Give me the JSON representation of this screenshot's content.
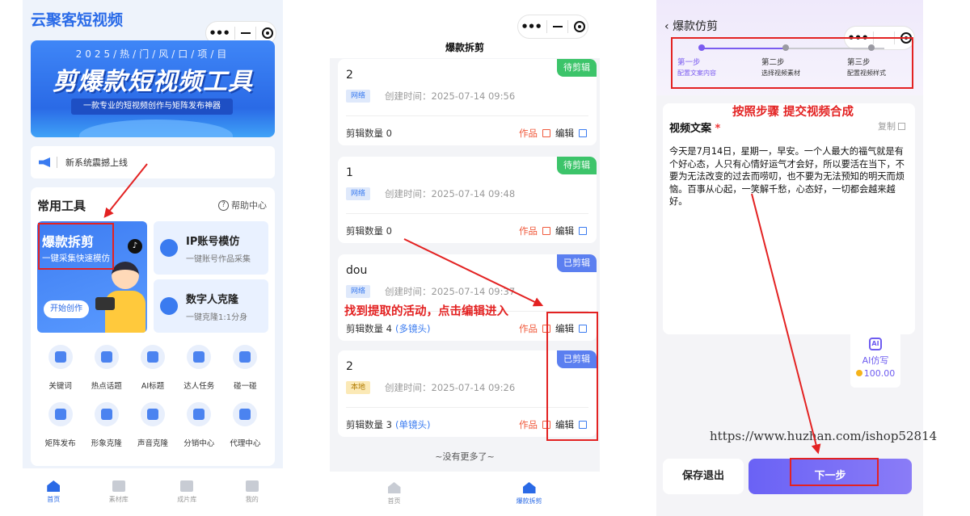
{
  "colors": {
    "accent_blue": "#2a6ae6",
    "accent_purple": "#7b5cf0",
    "annotation_red": "#e32222"
  },
  "capsule": {
    "dots": "•••"
  },
  "phone1": {
    "app_title": "云聚客短视频",
    "banner": {
      "year": "2025/热/门/风/口/项/目",
      "main": "剪爆款短视频工具",
      "sub": "一款专业的短视频创作与矩阵发布神器"
    },
    "notice": "新系统震撼上线",
    "tools_title": "常用工具",
    "help": "帮助中心",
    "big_tool": {
      "title": "爆款拆剪",
      "sub": "一键采集快速模仿",
      "button": "开始创作"
    },
    "small_tools": [
      {
        "title": "IP账号模仿",
        "sub": "一键账号作品采集",
        "icon": "user-star-icon"
      },
      {
        "title": "数字人克隆",
        "sub": "一键克隆1:1分身",
        "icon": "chat-bubble-icon"
      }
    ],
    "grid": [
      {
        "label": "关键词",
        "icon": "ai-image-icon"
      },
      {
        "label": "热点话题",
        "icon": "pen-icon"
      },
      {
        "label": "AI标题",
        "icon": "video-icon"
      },
      {
        "label": "达人任务",
        "icon": "star-icon"
      },
      {
        "label": "碰一碰",
        "icon": "dots-icon"
      },
      {
        "label": "矩阵发布",
        "icon": "grid-icon"
      },
      {
        "label": "形象克隆",
        "icon": "face-icon"
      },
      {
        "label": "声音克隆",
        "icon": "speaker-icon"
      },
      {
        "label": "分销中心",
        "icon": "share-icon"
      },
      {
        "label": "代理中心",
        "icon": "people-icon"
      }
    ],
    "tabs": [
      {
        "label": "首页",
        "icon": "home-icon",
        "active": true
      },
      {
        "label": "素材库",
        "icon": "folder-icon",
        "active": false
      },
      {
        "label": "成片库",
        "icon": "film-icon",
        "active": false
      },
      {
        "label": "我的",
        "icon": "user-icon",
        "active": false
      }
    ]
  },
  "phone2": {
    "title": "爆款拆剪",
    "created_prefix": "创建时间：",
    "count_prefix": "剪辑数量",
    "works_label": "作品",
    "edit_label": "编辑",
    "cards": [
      {
        "name": "2",
        "status": "待剪辑",
        "source": "网络",
        "time": "2025-07-14 09:56",
        "count": "0",
        "mode": ""
      },
      {
        "name": "1",
        "status": "待剪辑",
        "source": "网络",
        "time": "2025-07-14 09:48",
        "count": "0",
        "mode": ""
      },
      {
        "name": "dou",
        "status": "已剪辑",
        "source": "网络",
        "time": "2025-07-14 09:37",
        "count": "4",
        "mode": "(多镜头)"
      },
      {
        "name": "2",
        "status": "已剪辑",
        "source": "本地",
        "time": "2025-07-14 09:26",
        "count": "3",
        "mode": "(单镜头)"
      }
    ],
    "no_more": "~没有更多了~",
    "tabs": [
      {
        "label": "首页",
        "icon": "home-icon",
        "active": false
      },
      {
        "label": "爆款拆剪",
        "icon": "home-icon",
        "active": true
      }
    ]
  },
  "phone3": {
    "back_title": "爆款仿剪",
    "steps": [
      {
        "title": "第一步",
        "desc": "配置文案内容",
        "active": true
      },
      {
        "title": "第二步",
        "desc": "选择视频素材",
        "active": false
      },
      {
        "title": "第三步",
        "desc": "配置视频样式",
        "active": false
      }
    ],
    "copy_title": "视频文案",
    "required_mark": "*",
    "copy_button": "复制",
    "copy_text": "今天是7月14日，星期一，早安。一个人最大的福气就是有个好心态，人只有心情好运气才会好，所以要活在当下，不要为无法改变的过去而唠叨，也不要为无法预知的明天而烦恼。百事从心起，一笑解千愁，心态好，一切都会越来越好。",
    "ai": {
      "title": "AI仿写",
      "points": "100.00"
    },
    "save_button": "保存退出",
    "next_button": "下一步"
  },
  "annotations": {
    "find_activity": "找到提取的活动，点击编辑进入",
    "follow_steps": "按照步骤 提交视频合成"
  },
  "watermark": "https://www.huzhan.com/ishop52814"
}
